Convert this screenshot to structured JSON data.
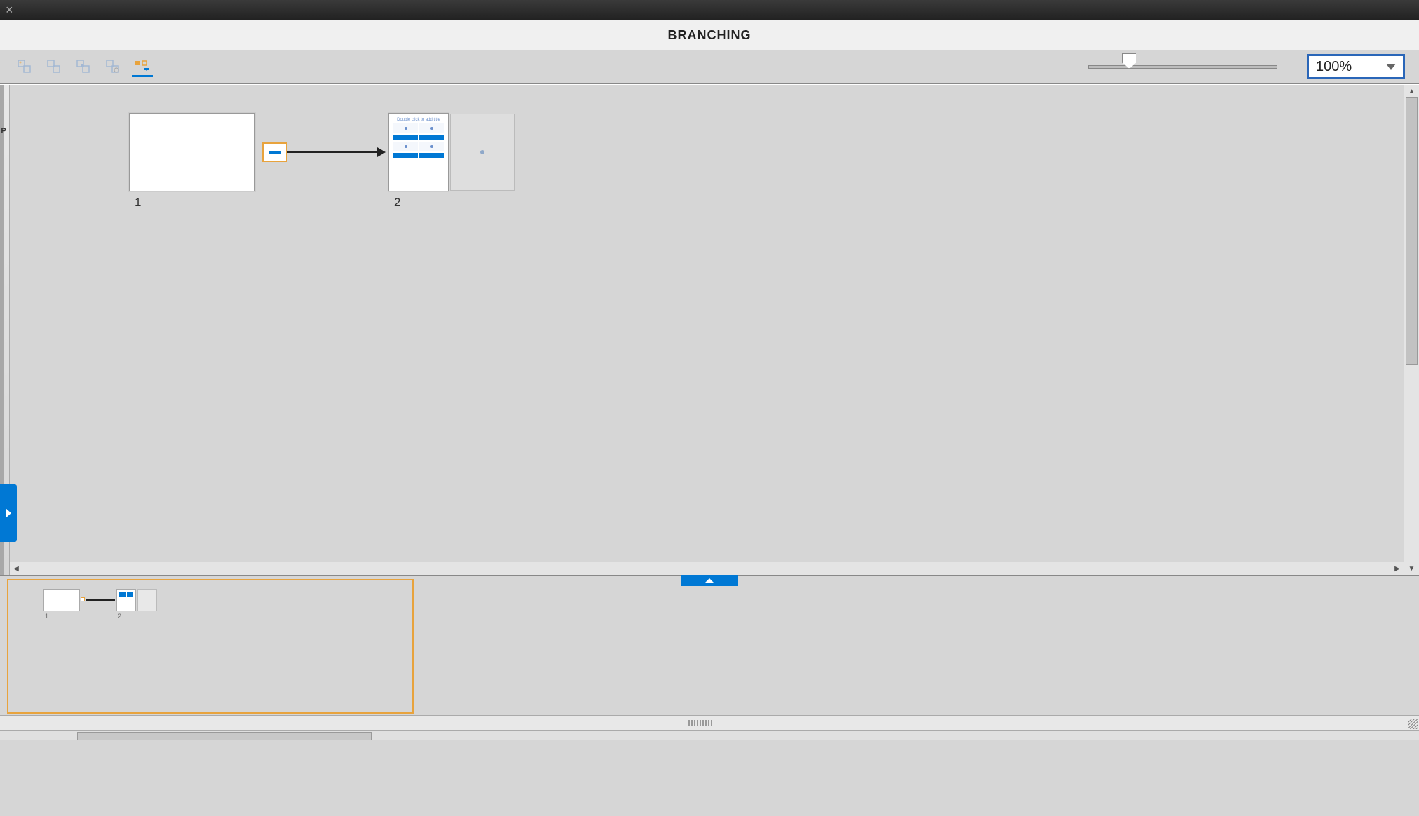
{
  "window": {
    "title": "BRANCHING"
  },
  "toolbar": {
    "zoom_value": "100%"
  },
  "slides": [
    {
      "id": "1",
      "label": "1"
    },
    {
      "id": "2",
      "label": "2",
      "quiz_title": "Double click to add title"
    }
  ],
  "nav": {
    "mini_labels": [
      "1",
      "2"
    ]
  }
}
